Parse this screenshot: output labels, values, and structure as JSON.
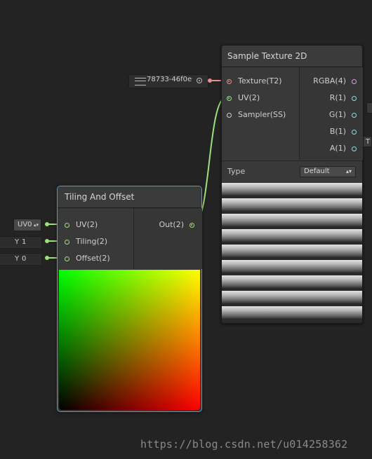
{
  "colors": {
    "background": "#232323",
    "node_body": "#393939",
    "selection_outline": "#4aa0d8",
    "uv_port": "#9be27a",
    "texture_port": "#e89090",
    "vector_port": "#8be0e0",
    "connection": "#9be27a"
  },
  "sample_texture": {
    "title": "Sample Texture 2D",
    "texture_field": "78733-46f0e",
    "inputs": [
      "Texture(T2)",
      "UV(2)",
      "Sampler(SS)"
    ],
    "outputs": [
      "RGBA(4)",
      "R(1)",
      "G(1)",
      "B(1)",
      "A(1)"
    ],
    "type_label": "Type",
    "type_value": "Default"
  },
  "tiling_offset": {
    "title": "Tiling And Offset",
    "inputs": [
      "UV(2)",
      "Tiling(2)",
      "Offset(2)"
    ],
    "output": "Out(2)",
    "uv_field": "UV0",
    "tiling_y_label": "Y",
    "tiling_y_value": "1",
    "offset_y_label": "Y",
    "offset_y_value": "0"
  },
  "edge_fragment": "T",
  "watermark": "https://blog.csdn.net/u014258362"
}
